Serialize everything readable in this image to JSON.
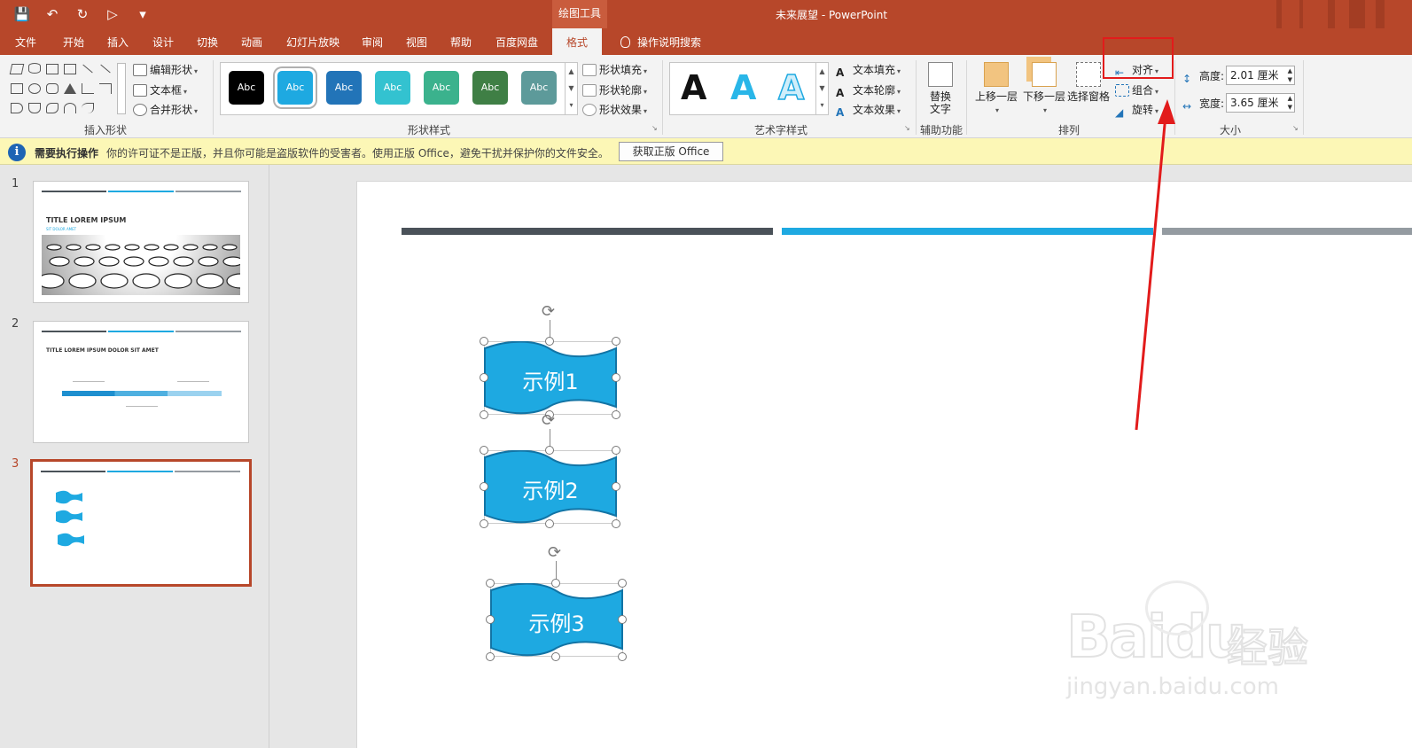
{
  "titlebar": {
    "title": "未来展望 - PowerPoint",
    "context_tab": "绘图工具"
  },
  "tabs": [
    "文件",
    "开始",
    "插入",
    "设计",
    "切换",
    "动画",
    "幻灯片放映",
    "审阅",
    "视图",
    "帮助",
    "百度网盘"
  ],
  "active_tab": "格式",
  "tell_me": "操作说明搜索",
  "ribbon": {
    "insert_shapes": {
      "label": "插入形状",
      "edit_shape": "编辑形状",
      "text_box": "文本框",
      "merge_shapes": "合并形状"
    },
    "shape_styles": {
      "label": "形状样式",
      "swatch_text": "Abc",
      "swatch_colors": [
        "#000000",
        "#1ea9e1",
        "#2274b8",
        "#33c2d0",
        "#3bb28d",
        "#3f7f45",
        "#5d9a9a"
      ],
      "fill": "形状填充",
      "outline": "形状轮廓",
      "effects": "形状效果"
    },
    "wordart": {
      "label": "艺术字样式",
      "glyph": "A",
      "text_fill": "文本填充",
      "text_outline": "文本轮廓",
      "text_effects": "文本效果"
    },
    "accessibility": {
      "label": "辅助功能",
      "alt_text_line1": "替换",
      "alt_text_line2": "文字"
    },
    "arrange": {
      "label": "排列",
      "bring_forward": "上移一层",
      "send_backward": "下移一层",
      "selection_pane": "选择窗格",
      "align": "对齐",
      "group": "组合",
      "rotate": "旋转"
    },
    "size": {
      "label": "大小",
      "height_label": "高度:",
      "height_value": "2.01 厘米",
      "width_label": "宽度:",
      "width_value": "3.65 厘米"
    }
  },
  "infobar": {
    "title": "需要执行操作",
    "message": "你的许可证不是正版，并且你可能是盗版软件的受害者。使用正版 Office，避免干扰并保护你的文件安全。",
    "button": "获取正版 Office"
  },
  "slides": [
    {
      "number": "1",
      "title": "TITLE LOREM IPSUM",
      "subtitle": "SIT DOLOR AMET"
    },
    {
      "number": "2",
      "title": "TITLE LOREM IPSUM DOLOR SIT AMET"
    },
    {
      "number": "3"
    }
  ],
  "canvas": {
    "shapes": [
      "示例1",
      "示例2",
      "示例3"
    ]
  },
  "watermark": {
    "brand": "Bai",
    "brand2": "du",
    "jingyan": "经验",
    "url": "jingyan.baidu.com"
  },
  "colors": {
    "accent": "#b7472a",
    "shape_fill": "#1ea9e1",
    "bar_dark": "#4a5259",
    "bar_blue": "#1ea9e1",
    "bar_gray": "#949ba1",
    "highlight": "#e21b1b"
  }
}
